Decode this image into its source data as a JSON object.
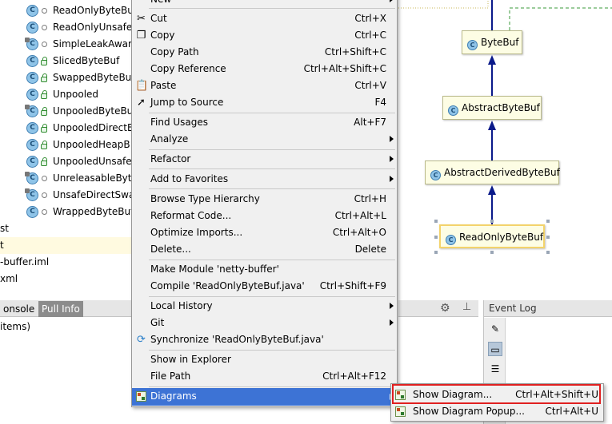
{
  "tree": {
    "classes": [
      {
        "label": "ReadOnlyByteBuf",
        "visibility": "package",
        "marker": "plain"
      },
      {
        "label": "ReadOnlyUnsafe",
        "visibility": "package",
        "marker": "plain"
      },
      {
        "label": "SimpleLeakAware",
        "visibility": "package",
        "marker": "leak"
      },
      {
        "label": "SlicedByteBuf",
        "visibility": "public",
        "marker": "plain"
      },
      {
        "label": "SwappedByteBuf",
        "visibility": "public",
        "marker": "plain"
      },
      {
        "label": "Unpooled",
        "visibility": "public",
        "marker": "plain"
      },
      {
        "label": "UnpooledByteBu",
        "visibility": "public",
        "marker": "leak"
      },
      {
        "label": "UnpooledDirectB",
        "visibility": "public",
        "marker": "plain"
      },
      {
        "label": "UnpooledHeapB",
        "visibility": "public",
        "marker": "plain"
      },
      {
        "label": "UnpooledUnsafe",
        "visibility": "public",
        "marker": "plain"
      },
      {
        "label": "UnreleasableByte",
        "visibility": "package",
        "marker": "leak"
      },
      {
        "label": "UnsafeDirectSwa",
        "visibility": "package",
        "marker": "leak"
      },
      {
        "label": "WrappedByteBuf",
        "visibility": "package",
        "marker": "plain"
      }
    ],
    "plain_rows": [
      "st",
      "t",
      "-buffer.iml",
      "xml"
    ]
  },
  "bottom": {
    "tabs": [
      "onsole",
      "Pull Info"
    ],
    "items_text": "items)"
  },
  "event_log": {
    "title": "Event Log"
  },
  "diagram": {
    "nodes": [
      "ByteBuf",
      "AbstractByteBuf",
      "AbstractDerivedByteBuf",
      "ReadOnlyByteBuf"
    ]
  },
  "menu": {
    "items": [
      {
        "label": "New",
        "shortcut": "",
        "submenu": true,
        "icon": ""
      },
      {
        "label": "Cut",
        "shortcut": "Ctrl+X",
        "submenu": false,
        "icon": "scissors-icon"
      },
      {
        "label": "Copy",
        "shortcut": "Ctrl+C",
        "submenu": false,
        "icon": "copy-icon"
      },
      {
        "label": "Copy Path",
        "shortcut": "Ctrl+Shift+C",
        "submenu": false,
        "icon": ""
      },
      {
        "label": "Copy Reference",
        "shortcut": "Ctrl+Alt+Shift+C",
        "submenu": false,
        "icon": ""
      },
      {
        "label": "Paste",
        "shortcut": "Ctrl+V",
        "submenu": false,
        "icon": "paste-icon"
      },
      {
        "label": "Jump to Source",
        "shortcut": "F4",
        "submenu": false,
        "icon": "jump-icon"
      },
      {
        "label": "Find Usages",
        "shortcut": "Alt+F7",
        "submenu": false,
        "icon": ""
      },
      {
        "label": "Analyze",
        "shortcut": "",
        "submenu": true,
        "icon": ""
      },
      {
        "label": "Refactor",
        "shortcut": "",
        "submenu": true,
        "icon": ""
      },
      {
        "label": "Add to Favorites",
        "shortcut": "",
        "submenu": true,
        "icon": ""
      },
      {
        "label": "Browse Type Hierarchy",
        "shortcut": "Ctrl+H",
        "submenu": false,
        "icon": ""
      },
      {
        "label": "Reformat Code...",
        "shortcut": "Ctrl+Alt+L",
        "submenu": false,
        "icon": ""
      },
      {
        "label": "Optimize Imports...",
        "shortcut": "Ctrl+Alt+O",
        "submenu": false,
        "icon": ""
      },
      {
        "label": "Delete...",
        "shortcut": "Delete",
        "submenu": false,
        "icon": ""
      },
      {
        "label": "Make Module 'netty-buffer'",
        "shortcut": "",
        "submenu": false,
        "icon": ""
      },
      {
        "label": "Compile 'ReadOnlyByteBuf.java'",
        "shortcut": "Ctrl+Shift+F9",
        "submenu": false,
        "icon": ""
      },
      {
        "label": "Local History",
        "shortcut": "",
        "submenu": true,
        "icon": ""
      },
      {
        "label": "Git",
        "shortcut": "",
        "submenu": true,
        "icon": ""
      },
      {
        "label": "Synchronize 'ReadOnlyByteBuf.java'",
        "shortcut": "",
        "submenu": false,
        "icon": "sync-icon"
      },
      {
        "label": "Show in Explorer",
        "shortcut": "",
        "submenu": false,
        "icon": ""
      },
      {
        "label": "File Path",
        "shortcut": "Ctrl+Alt+F12",
        "submenu": false,
        "icon": ""
      },
      {
        "label": "Diagrams",
        "shortcut": "",
        "submenu": true,
        "icon": "diagram-icon"
      }
    ]
  },
  "submenu": {
    "items": [
      {
        "label": "Show Diagram...",
        "shortcut": "Ctrl+Alt+Shift+U"
      },
      {
        "label": "Show Diagram Popup...",
        "shortcut": "Ctrl+Alt+U"
      }
    ]
  },
  "colors": {
    "highlight": "#3d73d5",
    "diagram_edge": "#0a1a8a",
    "callout": "#e02020"
  }
}
